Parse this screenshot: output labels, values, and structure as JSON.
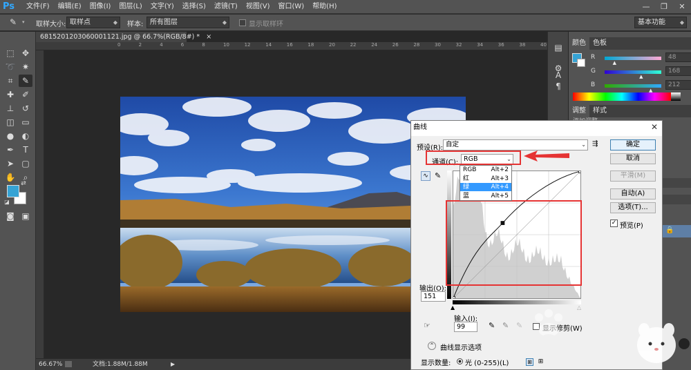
{
  "app": {
    "logo": "Ps"
  },
  "menu": [
    "文件(F)",
    "编辑(E)",
    "图像(I)",
    "图层(L)",
    "文字(Y)",
    "选择(S)",
    "滤镜(T)",
    "视图(V)",
    "窗口(W)",
    "帮助(H)"
  ],
  "window_controls": {
    "minimize": "—",
    "restore": "❐",
    "close": "✕"
  },
  "options_bar": {
    "sample_size_label": "取样大小:",
    "sample_size_value": "取样点",
    "sample_label": "样本:",
    "sample_value": "所有图层",
    "show_ring_label": "显示取样环",
    "workspace": "基本功能"
  },
  "document": {
    "tab_title": "6815201203060001121.jpg @ 66.7%(RGB/8#) *",
    "tab_close": "×",
    "zoom": "66.67%",
    "doc_size": "文档:1.88M/1.88M"
  },
  "ruler_ticks": [
    "0",
    "2",
    "4",
    "6",
    "8",
    "10",
    "12",
    "14",
    "16",
    "18",
    "20",
    "22",
    "24",
    "26",
    "28",
    "30",
    "32",
    "34",
    "36",
    "38",
    "40",
    "42"
  ],
  "panels": {
    "color_tab": "颜色",
    "swatches_tab": "色板",
    "channels": [
      {
        "label": "R",
        "value": "48",
        "level": 0.19
      },
      {
        "label": "G",
        "value": "168",
        "level": 0.66
      },
      {
        "label": "B",
        "value": "212",
        "level": 0.83
      }
    ],
    "adjust_tab": "调整",
    "styles_tab": "样式",
    "adjust_hint": "添加调整"
  },
  "curves": {
    "title": "曲线",
    "close": "✕",
    "preset_label": "预设(R):",
    "preset_value": "自定",
    "channel_label": "通道(C):",
    "channel_value": "RGB",
    "channel_options": [
      {
        "name": "RGB",
        "shortcut": "Alt+2"
      },
      {
        "name": "红",
        "shortcut": "Alt+3"
      },
      {
        "name": "绿",
        "shortcut": "Alt+4"
      },
      {
        "name": "蓝",
        "shortcut": "Alt+5"
      }
    ],
    "selected_option": 2,
    "buttons": {
      "ok": "确定",
      "cancel": "取消",
      "smooth": "平滑(M)",
      "auto": "自动(A)",
      "options": "选项(T)..."
    },
    "preview_label": "预览(P)",
    "output_label": "输出(O):",
    "output_value": "151",
    "input_label": "输入(I):",
    "input_value": "99",
    "clipping_label": "显示修剪(W)",
    "display_options_label": "曲线显示选项",
    "show_amount_label": "显示数量:",
    "light_option": "光 (0-255)(L)",
    "curve_points": [
      [
        0,
        0
      ],
      [
        99,
        151
      ],
      [
        255,
        255
      ]
    ]
  }
}
